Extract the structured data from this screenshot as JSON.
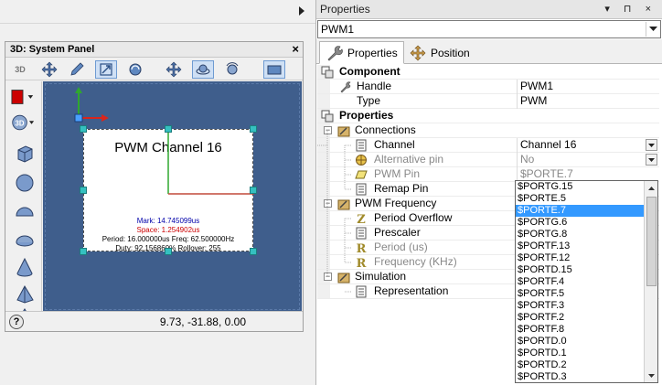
{
  "system_panel": {
    "title": "3D: System Panel",
    "close_label": "×",
    "toolbar_badge": "3D",
    "view_badge": "3D",
    "component": {
      "title": "PWM Channel 16",
      "mark": "Mark: 14.745099us",
      "space": "Space: 1.254902us",
      "period_freq": "Period: 16.000000us Freq: 62.500000Hz",
      "duty_rollover": "Duty: 92.156860%  Rollover: 255"
    },
    "status": {
      "help_label": "?",
      "coordinates": "9.73, -31.88, 0.00"
    }
  },
  "properties": {
    "title": "Properties",
    "title_controls": "▾ ⊓ ×",
    "component_name": "PWM1",
    "tabs": [
      {
        "label": "Properties",
        "active": true
      },
      {
        "label": "Position",
        "active": false
      }
    ],
    "rows": [
      {
        "type": "section",
        "label": "Component"
      },
      {
        "type": "prop",
        "label": "Handle",
        "value": "PWM1",
        "disabled": false
      },
      {
        "type": "prop",
        "label": "Type",
        "value": "PWM",
        "disabled": false
      },
      {
        "type": "section",
        "label": "Properties"
      },
      {
        "type": "group",
        "label": "Connections"
      },
      {
        "type": "prop",
        "label": "Channel",
        "value": "Channel 16",
        "disabled": false,
        "dropdown": true
      },
      {
        "type": "prop",
        "label": "Alternative pin",
        "value": "No",
        "disabled": true,
        "dropdown": true
      },
      {
        "type": "prop",
        "label": "PWM Pin",
        "value": "$PORTE.7",
        "disabled": true
      },
      {
        "type": "prop",
        "label": "Remap Pin",
        "value": "",
        "disabled": false
      },
      {
        "type": "group",
        "label": "PWM Frequency"
      },
      {
        "type": "prop",
        "label": "Period Overflow",
        "value": "",
        "disabled": false
      },
      {
        "type": "prop",
        "label": "Prescaler",
        "value": "",
        "disabled": false
      },
      {
        "type": "prop",
        "label": "Period (us)",
        "value": "",
        "disabled": true
      },
      {
        "type": "prop",
        "label": "Frequency (KHz)",
        "value": "",
        "disabled": true
      },
      {
        "type": "group",
        "label": "Simulation"
      },
      {
        "type": "prop",
        "label": "Representation",
        "value": "",
        "disabled": false
      }
    ],
    "pin_dropdown": {
      "selected": "$PORTE.7",
      "options": [
        "$PORTG.15",
        "$PORTE.5",
        "$PORTE.7",
        "$PORTG.6",
        "$PORTG.8",
        "$PORTF.13",
        "$PORTF.12",
        "$PORTD.15",
        "$PORTF.4",
        "$PORTF.5",
        "$PORTF.3",
        "$PORTF.2",
        "$PORTF.8",
        "$PORTD.0",
        "$PORTD.1",
        "$PORTD.2",
        "$PORTD.3"
      ]
    }
  },
  "colors": {
    "viewport_bg": "#3f5e8c",
    "selection_blue": "#3399ff",
    "axis_red": "#d9261c",
    "axis_green": "#2fa82f",
    "mark_color": "#0000aa",
    "space_color": "#cc0000"
  }
}
